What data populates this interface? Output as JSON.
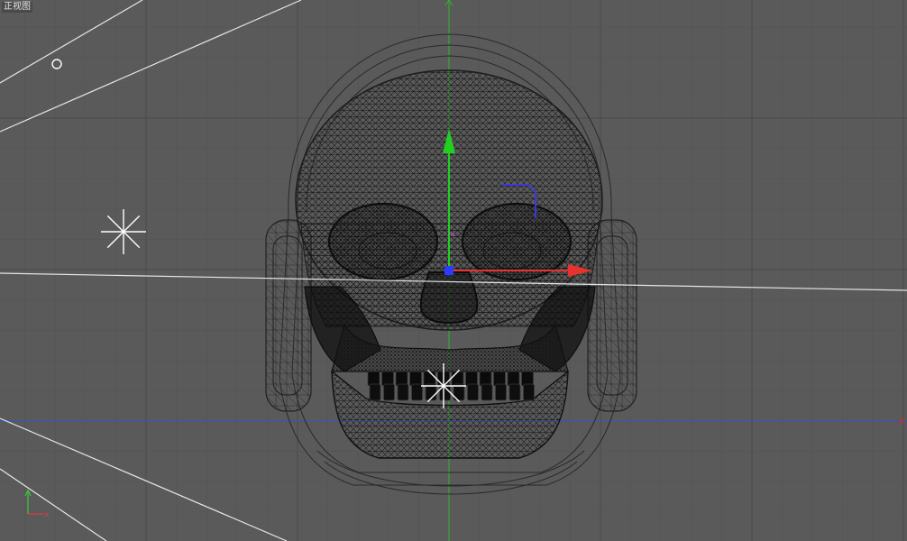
{
  "viewport": {
    "title": "正视图",
    "background": "#5a5a5a",
    "grid_major_color": "#4a4a4a",
    "grid_minor_color": "#545454"
  },
  "world_axes": {
    "vertical_color": "#2fb52f",
    "horizontal_color": "#3550c8",
    "end_marker_color": "#c83030"
  },
  "gizmo": {
    "x_color": "#e8322f",
    "y_color": "#22d022",
    "z_color": "#3a3ad8",
    "center_color": "#2b3bff"
  },
  "lights": {
    "ray_color": "#dfe8ec",
    "icon_color": "#ffffff"
  },
  "axis_indicator": {
    "x_label": "x",
    "x_color": "#e03a3a",
    "y_color": "#3ac83a"
  }
}
